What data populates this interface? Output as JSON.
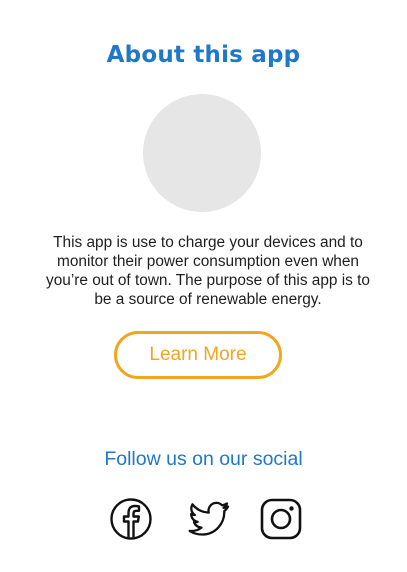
{
  "about": {
    "title": "About this app",
    "description": "This app is use to charge your devices and to monitor their power consumption even when you’re out of town. The purpose of this app is to be a source of renewable energy.",
    "learn_more_label": "Learn More"
  },
  "social": {
    "heading": "Follow us on our social",
    "icons": [
      "facebook-icon",
      "twitter-icon",
      "instagram-icon"
    ]
  },
  "colors": {
    "title": "#1f78c8",
    "accent": "#f2a51f",
    "avatar_placeholder": "#e6e6e6",
    "body_text": "#1e1e1e"
  }
}
